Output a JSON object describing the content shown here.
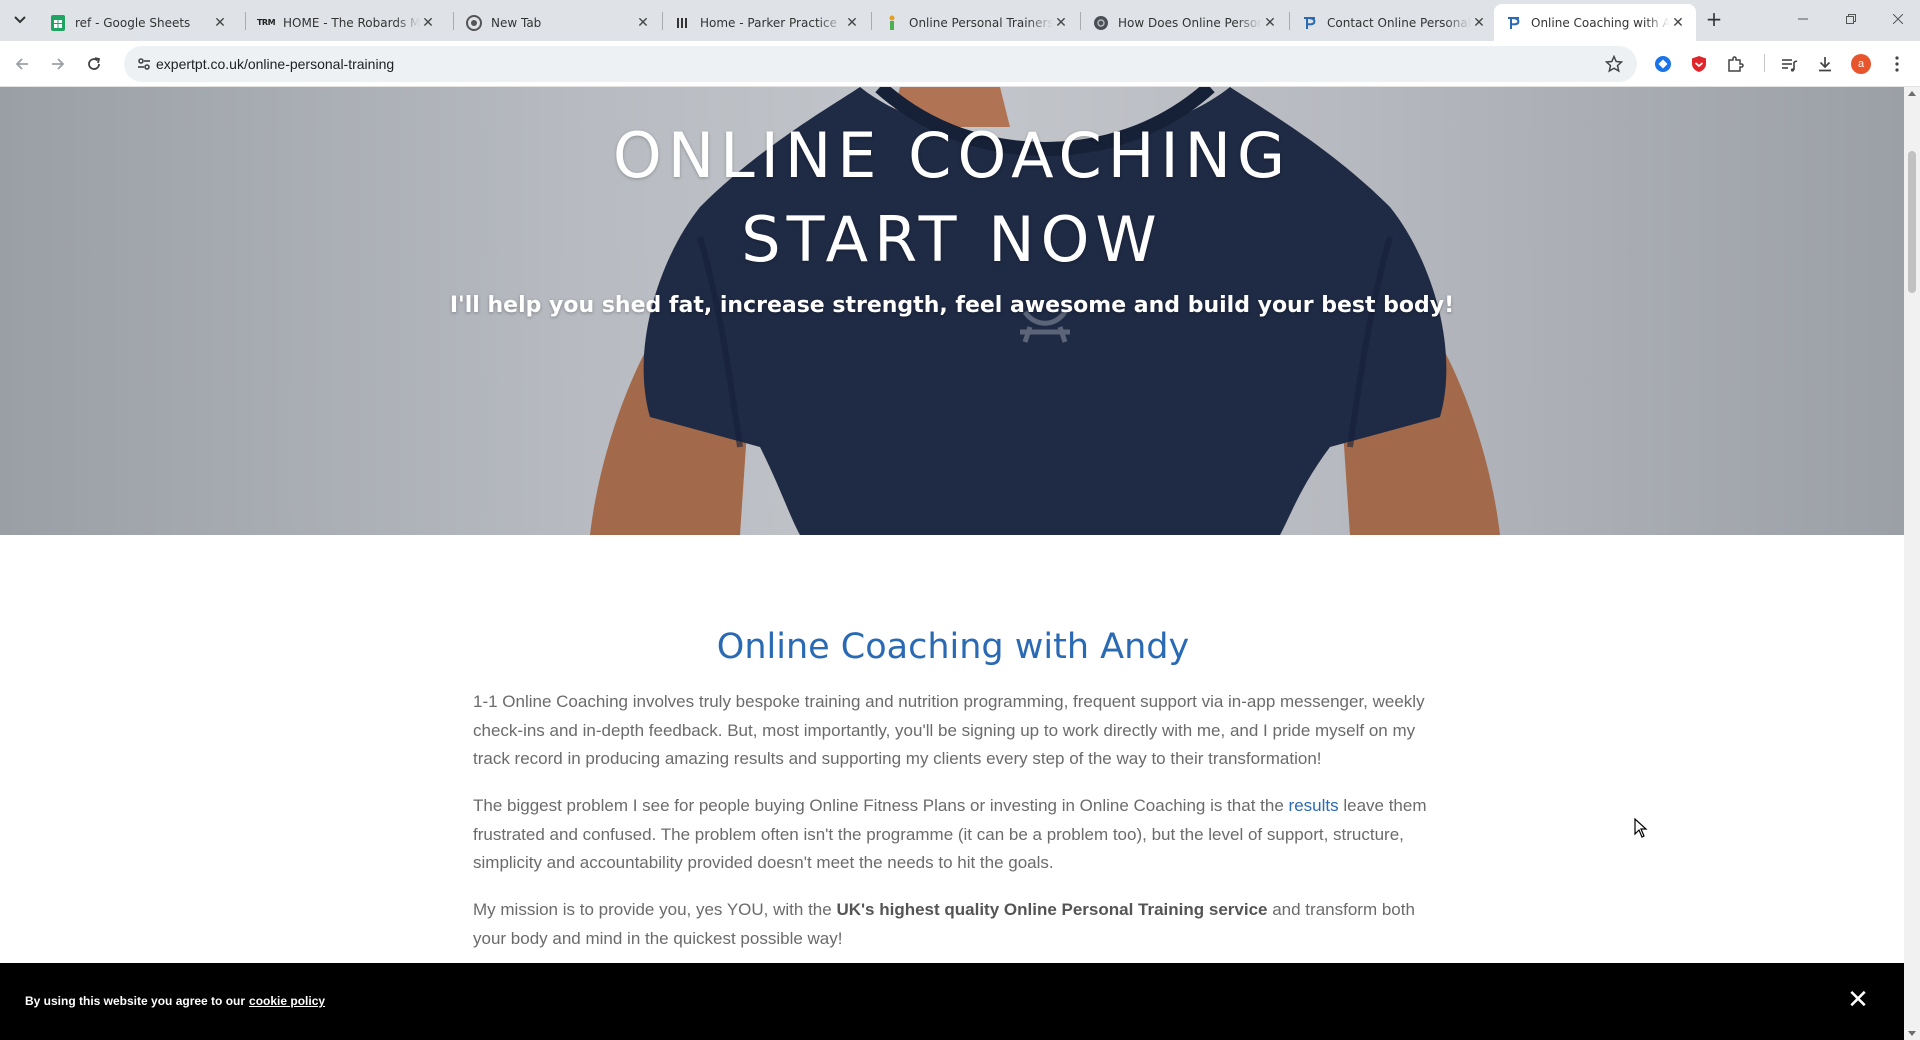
{
  "browser": {
    "tabs": [
      {
        "title": "ref - Google Sheets",
        "icon": "google-sheets-icon",
        "active": false
      },
      {
        "title": "HOME - The Robards Method",
        "icon": "trm-logo-icon",
        "active": false
      },
      {
        "title": "New Tab",
        "icon": "chrome-icon",
        "active": false
      },
      {
        "title": "Home - Parker Practice",
        "icon": "parker-icon",
        "active": false
      },
      {
        "title": "Online Personal Trainers - ",
        "icon": "trainer-figure-icon",
        "active": false
      },
      {
        "title": "How Does Online Personal",
        "icon": "globe-dark-icon",
        "active": false
      },
      {
        "title": "Contact Online Personal T",
        "icon": "expertpt-icon",
        "active": false
      },
      {
        "title": "Online Coaching with Andy",
        "icon": "expertpt-icon",
        "active": true
      }
    ],
    "trm_logo_text": "TRM",
    "new_tab_label": "+",
    "url": "expertpt.co.uk/online-personal-training",
    "profile_initial": "a",
    "colors": {
      "tabstrip": "#dfe3e8",
      "accent_blue": "#2a6ab4",
      "profile": "#e8542c"
    }
  },
  "hero": {
    "title_line1": "ONLINE COACHING",
    "title_line2": "START NOW",
    "subtitle": "I'll help you shed fat, increase strength, feel awesome and build your best body!"
  },
  "main": {
    "heading": "Online Coaching with Andy",
    "p1": "1-1 Online Coaching involves truly bespoke training and nutrition programming, frequent support via in-app messenger, weekly check-ins and in-depth feedback. But, most importantly, you'll be signing up to work directly with me, and I pride myself on my track record in producing amazing results and supporting my clients every step of the way to their transformation!",
    "p2_before": "The biggest problem I see for people buying Online Fitness Plans or investing in Online Coaching is that the ",
    "p2_link": "results",
    "p2_after": " leave them frustrated and confused. The problem often isn't the programme (it can be a problem too), but the level of support, structure, simplicity and accountability provided doesn't meet the needs to hit the goals.",
    "p3_before": "My mission is to provide you, yes YOU, with the ",
    "p3_bold": "UK's highest quality Online Personal Training service",
    "p3_after": " and transform both your body and mind in the quickest possible way!"
  },
  "cookie_banner": {
    "message": "By using this website you agree to our",
    "link": "cookie policy",
    "close": "✕"
  }
}
